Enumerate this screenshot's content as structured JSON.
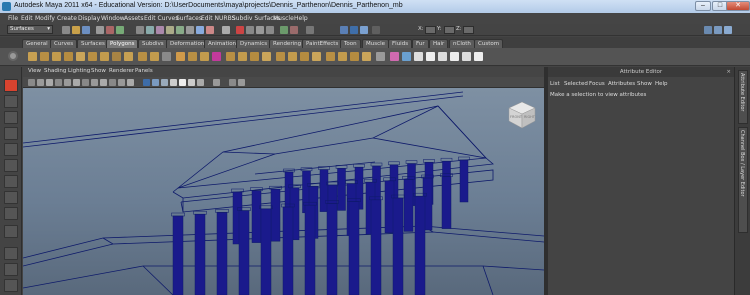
{
  "window": {
    "title": "Autodesk Maya 2011 x64 - Educational Version: D:\\UserDocuments\\maya\\projects\\Dennis_Parthenon\\Dennis_Parthenon_mb",
    "minimize": "–",
    "maximize": "□",
    "close": "✕"
  },
  "menubar": {
    "items": [
      "File",
      "Edit",
      "Modify",
      "Create",
      "Display",
      "Window",
      "Assets",
      "Edit Curves",
      "Surfaces",
      "Edit NURBS",
      "Subdiv Surfaces",
      "Muscle",
      "Help"
    ]
  },
  "status_line": {
    "mode": "Surfaces",
    "mode_arrow": "▾",
    "x_label": "X:",
    "y_label": "Y:",
    "z_label": "Z:"
  },
  "shelf_tabs": {
    "items": [
      "General",
      "Curves",
      "Surfaces",
      "Polygons",
      "Subdivs",
      "Deformation",
      "Animation",
      "Dynamics",
      "Rendering",
      "PaintEffects",
      "Toon",
      "Muscle",
      "Fluids",
      "Fur",
      "Hair",
      "nCloth",
      "Custom"
    ],
    "active": "Polygons"
  },
  "viewport": {
    "menu": [
      "View",
      "Shading",
      "Lighting",
      "Show",
      "Renderer",
      "Panels"
    ],
    "cube_front_label": "FRONT",
    "cube_right_label": "RIGHT"
  },
  "attribute_editor": {
    "title": "Attribute Editor",
    "close": "×",
    "menu": [
      "List",
      "Selected",
      "Focus",
      "Attributes",
      "Show",
      "Help"
    ],
    "message": "Make a selection to view attributes"
  },
  "side_tabs": {
    "attribute_editor": "Attribute Editor",
    "channel_box": "Channel Box / Layer Editor"
  },
  "colors": {
    "accent": "#3d6ca8",
    "columns": "#1a1a8c",
    "wireframe": "#0e1a6a",
    "viewport_bg": "#6b7e94"
  }
}
